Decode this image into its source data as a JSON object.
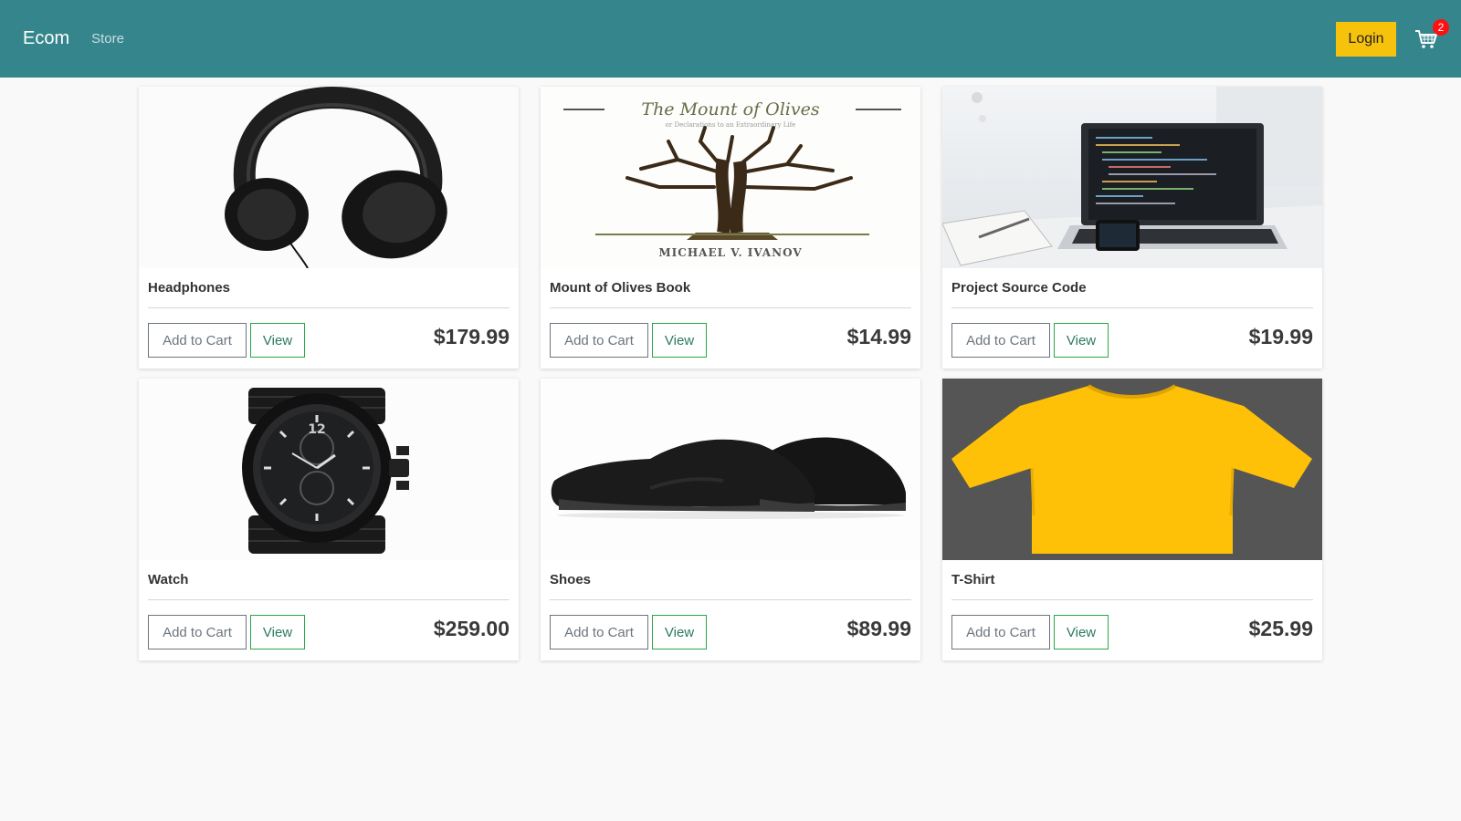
{
  "navbar": {
    "brand": "Ecom",
    "store_link": "Store",
    "login_label": "Login",
    "cart_count": "2",
    "accent_color": "#35868c",
    "login_color": "#f7c20c"
  },
  "products": [
    {
      "name": "Headphones",
      "price": "$179.99",
      "add_label": "Add to Cart",
      "view_label": "View",
      "image": "headphones"
    },
    {
      "name": "Mount of Olives Book",
      "price": "$14.99",
      "add_label": "Add to Cart",
      "view_label": "View",
      "image": "book",
      "book_title": "The Mount of Olives",
      "book_subtitle": "or Declarations to an Extraordinary Life",
      "book_author": "MICHAEL V. IVANOV"
    },
    {
      "name": "Project Source Code",
      "price": "$19.99",
      "add_label": "Add to Cart",
      "view_label": "View",
      "image": "laptop"
    },
    {
      "name": "Watch",
      "price": "$259.00",
      "add_label": "Add to Cart",
      "view_label": "View",
      "image": "watch",
      "watch_numeral": "12"
    },
    {
      "name": "Shoes",
      "price": "$89.99",
      "add_label": "Add to Cart",
      "view_label": "View",
      "image": "shoes"
    },
    {
      "name": "T-Shirt",
      "price": "$25.99",
      "add_label": "Add to Cart",
      "view_label": "View",
      "image": "tshirt"
    }
  ]
}
